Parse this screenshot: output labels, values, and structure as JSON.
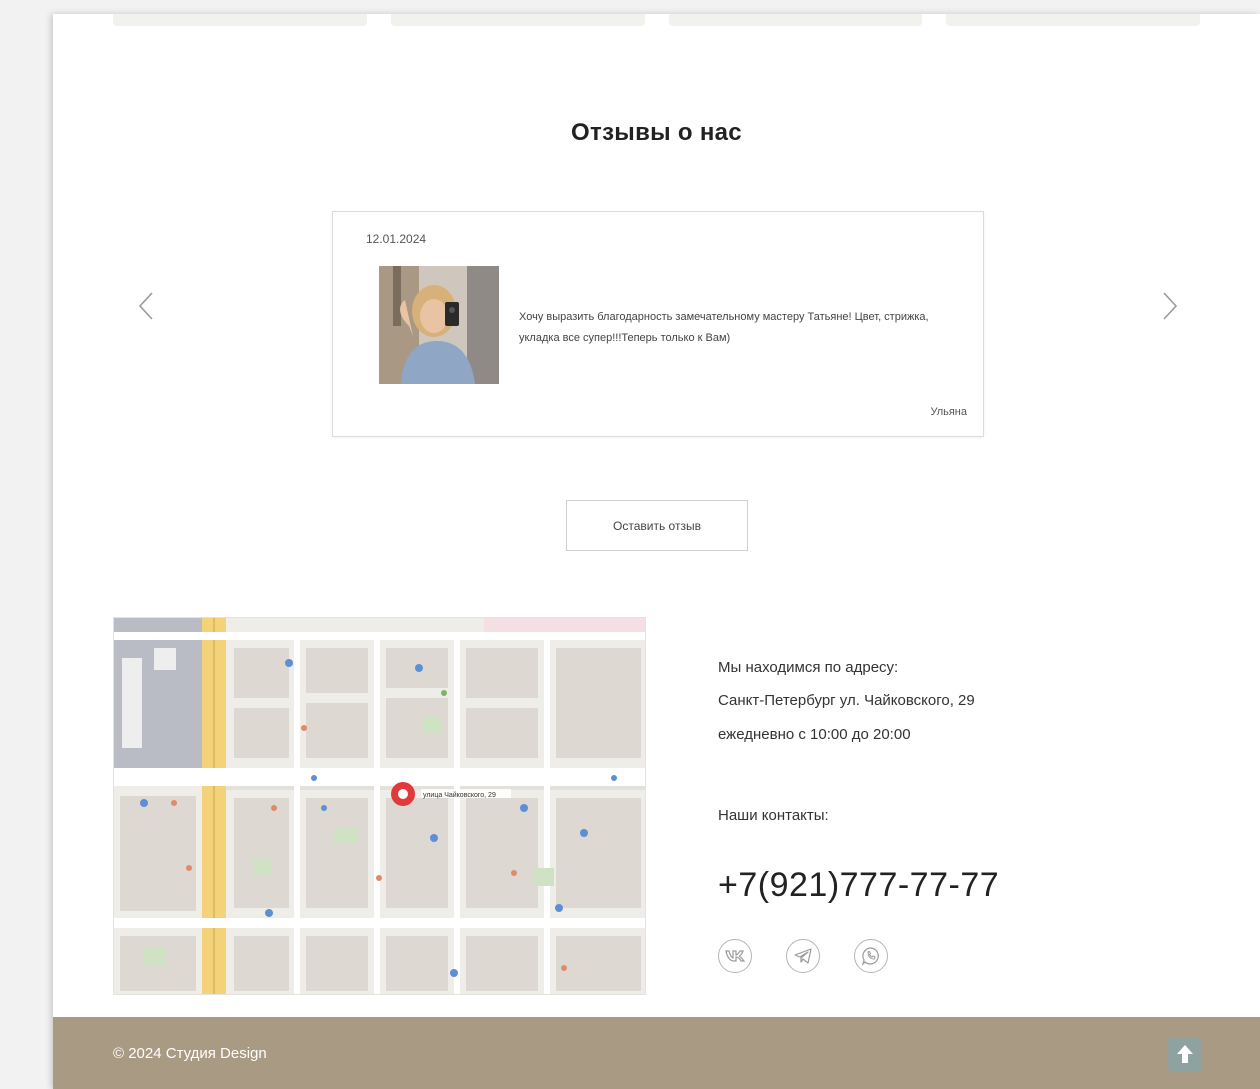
{
  "reviews_section": {
    "title": "Отзывы о нас",
    "review": {
      "date": "12.01.2024",
      "text": "Хочу выразить благодарность замечательному мастеру Татьяне! Цвет, стрижка, укладка все супер!!!Теперь только к Вам)",
      "author": "Ульяна"
    },
    "prev_icon": "chevron-left-icon",
    "next_icon": "chevron-right-icon",
    "leave_review_label": "Оставить отзыв"
  },
  "map": {
    "marker_label": "улица Чайковского, 29"
  },
  "contacts": {
    "address_label": "Мы находимся по адресу:",
    "address": "Санкт-Петербург ул. Чайковского, 29",
    "hours": "ежедневно с 10:00 до 20:00",
    "contacts_label": "Наши контакты:",
    "phone": "+7(921)777-77-77",
    "socials": [
      "vk-icon",
      "telegram-icon",
      "whatsapp-icon"
    ]
  },
  "footer": {
    "copyright": "© 2024 Студия Design",
    "to_top_icon": "arrow-up-icon"
  },
  "colors": {
    "footer_bg": "#a89a83",
    "to_top_bg": "#8ea2a0",
    "map_marker": "#e03a3a"
  }
}
